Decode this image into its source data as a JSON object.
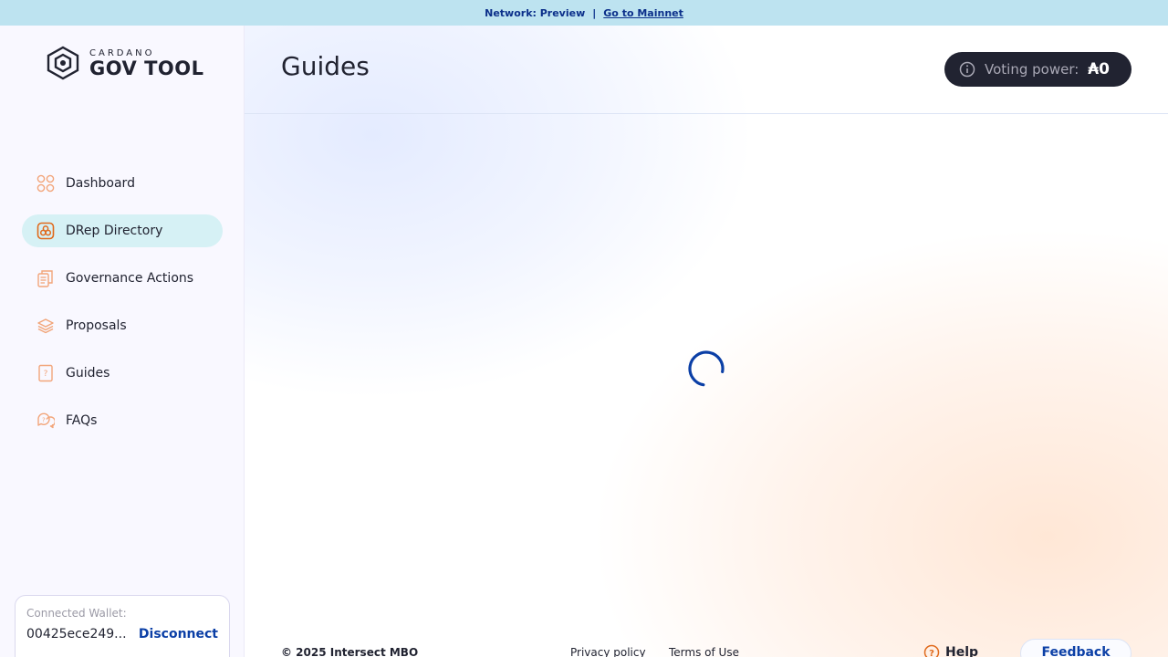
{
  "banner": {
    "network_text": "Network: Preview",
    "separator": "|",
    "link_text": "Go to Mainnet"
  },
  "logo": {
    "small": "CARDANO",
    "big": "GOV TOOL"
  },
  "sidebar": {
    "items": [
      {
        "label": "Dashboard",
        "icon": "dashboard-icon",
        "active": false
      },
      {
        "label": "DRep Directory",
        "icon": "drep-directory-icon",
        "active": true
      },
      {
        "label": "Governance Actions",
        "icon": "governance-actions-icon",
        "active": false
      },
      {
        "label": "Proposals",
        "icon": "proposals-icon",
        "active": false
      },
      {
        "label": "Guides",
        "icon": "guides-icon",
        "active": false
      },
      {
        "label": "FAQs",
        "icon": "faqs-icon",
        "active": false
      }
    ]
  },
  "wallet": {
    "label": "Connected Wallet:",
    "address": "00425ece249...",
    "disconnect": "Disconnect"
  },
  "header": {
    "title": "Guides",
    "voting_power_label": "Voting power:",
    "voting_power_value": "₳0"
  },
  "footer": {
    "copyright": "© 2025 Intersect MBO",
    "privacy": "Privacy policy",
    "terms": "Terms of Use",
    "help": "Help",
    "feedback": "Feedback"
  },
  "colors": {
    "banner_bg": "#bde3f0",
    "accent": "#0b3fa6",
    "active_nav_bg": "#d6f1f5",
    "icon_orange": "#f2a57a",
    "dark_pill": "#212331"
  }
}
